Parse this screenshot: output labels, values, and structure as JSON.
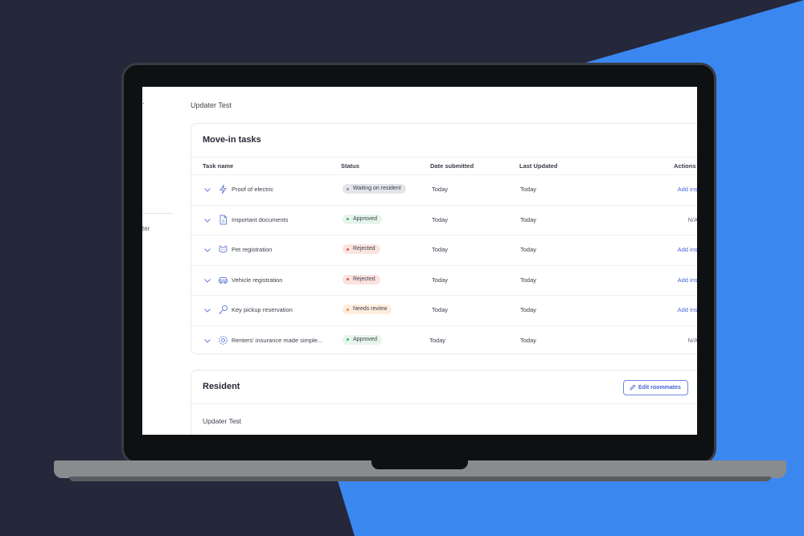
{
  "colors": {
    "background": "#25273a",
    "accent_blue": "#3b87f0",
    "link": "#4f6ad8"
  },
  "side": {
    "mark": "·",
    "text": "ter"
  },
  "page": {
    "title": "Updater Test"
  },
  "tasks": {
    "title": "Move-in tasks",
    "columns": {
      "task_name": "Task name",
      "status": "Status",
      "date_submitted": "Date submitted",
      "last_updated": "Last Updated",
      "actions": "Actions"
    },
    "rows": [
      {
        "icon": "lightning-icon",
        "name": "Proof of electric",
        "status": "Waiting on resident",
        "status_color": "#e4e5e9",
        "dot": "#8a8c95",
        "date_submitted": "Today",
        "last_updated": "Today",
        "action": "Add instructions"
      },
      {
        "icon": "document-icon",
        "name": "Important documents",
        "status": "Approved",
        "status_color": "#e6f5ec",
        "dot": "#3bb273",
        "date_submitted": "Today",
        "last_updated": "Today",
        "action": "N/A"
      },
      {
        "icon": "pet-icon",
        "name": "Pet registration",
        "status": "Rejected",
        "status_color": "#fbe3df",
        "dot": "#e0584b",
        "date_submitted": "Today",
        "last_updated": "Today",
        "action": "Add instructions"
      },
      {
        "icon": "car-icon",
        "name": "Vehicle registration",
        "status": "Rejected",
        "status_color": "#fbe3df",
        "dot": "#e0584b",
        "date_submitted": "Today",
        "last_updated": "Today",
        "action": "Add instructions"
      },
      {
        "icon": "key-icon",
        "name": "Key pickup reservation",
        "status": "Needs review",
        "status_color": "#fdeedd",
        "dot": "#f08a3a",
        "date_submitted": "Today",
        "last_updated": "Today",
        "action": "Add instructions"
      },
      {
        "icon": "gear-icon",
        "name": "Renters' insurance made simple...",
        "status": "Approved",
        "status_color": "#e6f5ec",
        "dot": "#3bb273",
        "date_submitted": "Today",
        "last_updated": "Today",
        "action": "N/A"
      }
    ]
  },
  "resident": {
    "title": "Resident",
    "edit_label": "Edit roommates",
    "name": "Updater Test"
  }
}
